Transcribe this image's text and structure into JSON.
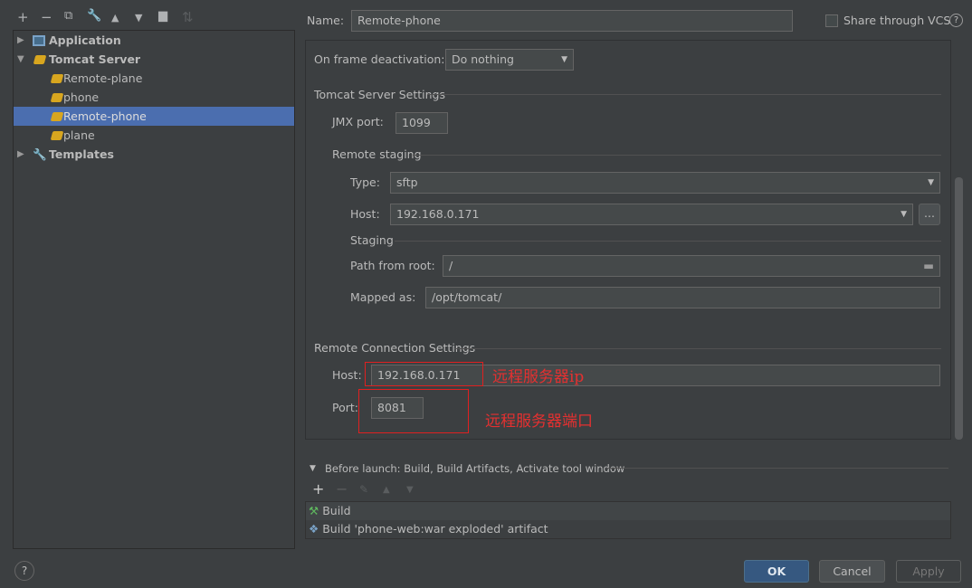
{
  "toolbar": {
    "icons": [
      "add-icon",
      "remove-icon",
      "copy-icon",
      "wrench-icon",
      "move-up-icon",
      "move-down-icon",
      "new-folder-icon",
      "sort-icon"
    ]
  },
  "tree": [
    {
      "label": "Application",
      "level": 0,
      "expanded": false,
      "bold": true
    },
    {
      "label": "Tomcat Server",
      "level": 0,
      "expanded": true,
      "bold": true
    },
    {
      "label": "Remote-plane",
      "level": 1
    },
    {
      "label": "phone",
      "level": 1
    },
    {
      "label": "Remote-phone",
      "level": 1,
      "selected": true
    },
    {
      "label": "plane",
      "level": 1
    },
    {
      "label": "Templates",
      "level": 0,
      "expanded": false,
      "bold": true
    }
  ],
  "header": {
    "name_label": "Name:",
    "name_value": "Remote-phone",
    "share_label": "Share through VCS",
    "share_checked": false
  },
  "form": {
    "frame_deactivation_label": "On frame deactivation:",
    "frame_deactivation_value": "Do nothing",
    "tomcat_settings_title": "Tomcat Server Settings",
    "jmx_label": "JMX port:",
    "jmx_value": "1099",
    "remote_staging_title": "Remote staging",
    "type_label": "Type:",
    "type_value": "sftp",
    "host_label": "Host:",
    "host_value": "192.168.0.171",
    "host_more": "...",
    "staging_title": "Staging",
    "path_label": "Path from root:",
    "path_value": "/",
    "mapped_label": "Mapped as:",
    "mapped_value": "/opt/tomcat/",
    "remote_conn_title": "Remote Connection Settings",
    "rc_host_label": "Host:",
    "rc_host_value": "192.168.0.171",
    "rc_port_label": "Port:",
    "rc_port_value": "8081"
  },
  "annotations": {
    "host_note": "远程服务器ip",
    "port_note": "远程服务器端口",
    "color": "#e02020"
  },
  "before_launch": {
    "title": "Before launch: Build, Build Artifacts, Activate tool window",
    "items": [
      "Build",
      "Build 'phone-web:war exploded' artifact"
    ]
  },
  "buttons": {
    "ok": "OK",
    "cancel": "Cancel",
    "apply": "Apply",
    "help": "?"
  },
  "colors": {
    "background": "#3c3f41",
    "selection": "#4b6eaf",
    "ok_button": "#365880"
  }
}
